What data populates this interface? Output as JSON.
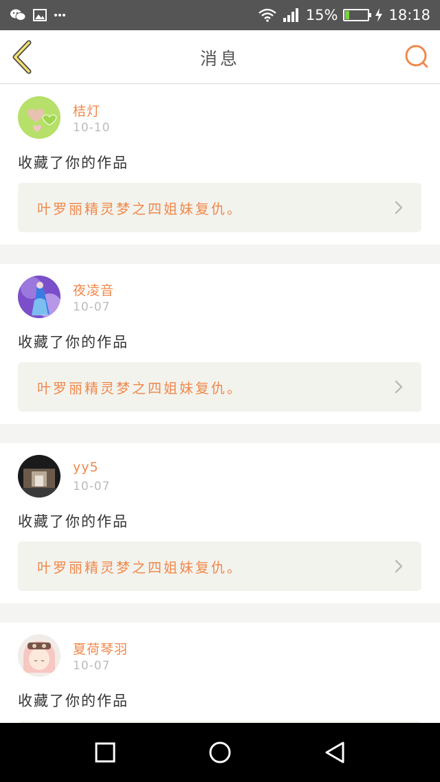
{
  "status_bar": {
    "battery_text": "15%",
    "battery_level": 0.15,
    "time": "18:18",
    "icons": [
      "wechat-icon",
      "image-icon",
      "more-dots-icon",
      "wifi-icon",
      "signal-icon",
      "battery-icon",
      "charging-icon"
    ]
  },
  "header": {
    "title": "消息",
    "back_icon": "chevron-left-icon",
    "search_icon": "search-icon",
    "accent": "#f0884a"
  },
  "messages": [
    {
      "username": "桔灯",
      "date": "10-10",
      "action": "收藏了你的作品",
      "work_title": "叶罗丽精灵梦之四姐妹复仇。"
    },
    {
      "username": "夜凌音",
      "date": "10-07",
      "action": "收藏了你的作品",
      "work_title": "叶罗丽精灵梦之四姐妹复仇。"
    },
    {
      "username": "yy5",
      "date": "10-07",
      "action": "收藏了你的作品",
      "work_title": "叶罗丽精灵梦之四姐妹复仇。"
    },
    {
      "username": "夏荷琴羽",
      "date": "10-07",
      "action": "收藏了你的作品",
      "work_title": ""
    }
  ],
  "nav": {
    "icons": [
      "recent-apps-icon",
      "home-icon",
      "back-triangle-icon"
    ]
  }
}
